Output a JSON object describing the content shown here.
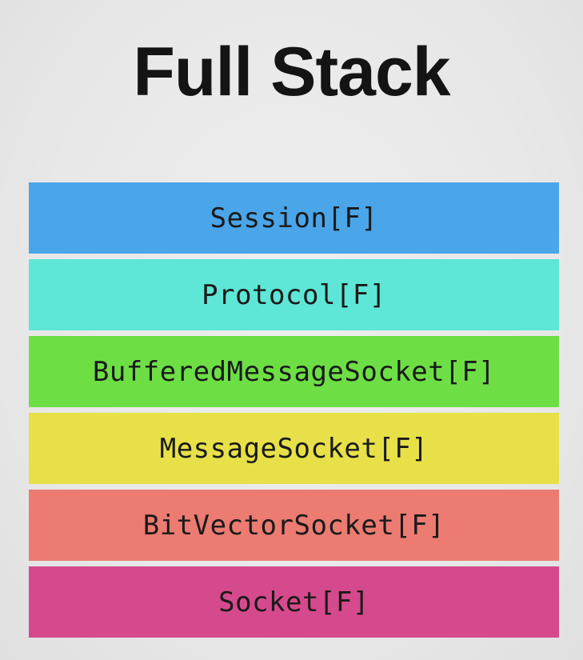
{
  "title": "Full Stack",
  "colors": {
    "background": "#e9e9e9",
    "title": "#141414",
    "layer_text": "#1a1a1a"
  },
  "layers": [
    {
      "label": "Session[F]",
      "color": "#4aa5e9"
    },
    {
      "label": "Protocol[F]",
      "color": "#5ee6d6"
    },
    {
      "label": "BufferedMessageSocket[F]",
      "color": "#6ddf45"
    },
    {
      "label": "MessageSocket[F]",
      "color": "#e7e048"
    },
    {
      "label": "BitVectorSocket[F]",
      "color": "#ec7b72"
    },
    {
      "label": "Socket[F]",
      "color": "#d54a8c"
    }
  ]
}
